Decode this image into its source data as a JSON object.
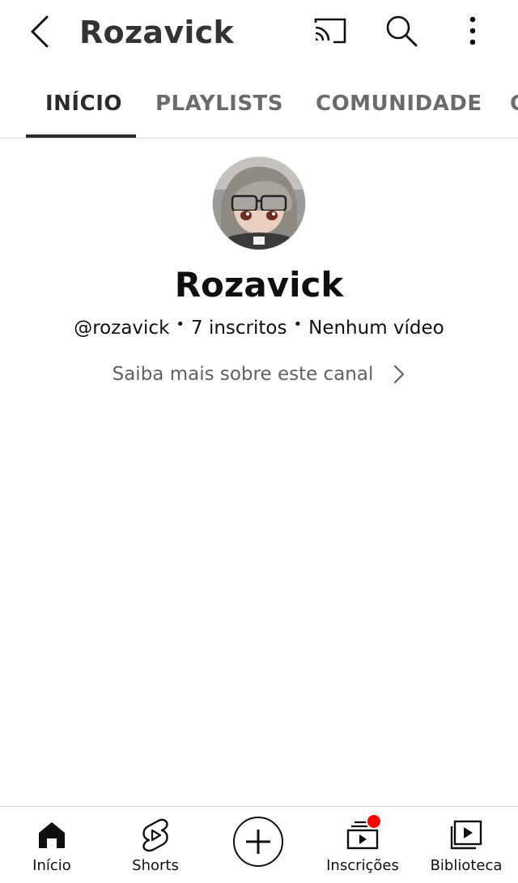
{
  "header": {
    "title": "Rozavick"
  },
  "tabs": [
    {
      "label": "INÍCIO",
      "active": true
    },
    {
      "label": "PLAYLISTS",
      "active": false
    },
    {
      "label": "COMUNIDADE",
      "active": false
    },
    {
      "label": "C",
      "active": false
    }
  ],
  "channel": {
    "name": "Rozavick",
    "handle": "@rozavick",
    "subscribers": "7 inscritos",
    "videos": "Nenhum vídeo",
    "separator": "•",
    "about_link": "Saiba mais sobre este canal"
  },
  "bottom_nav": {
    "items": [
      {
        "label": "Início",
        "icon": "home-icon"
      },
      {
        "label": "Shorts",
        "icon": "shorts-icon"
      },
      {
        "label": "",
        "icon": "create-icon"
      },
      {
        "label": "Inscrições",
        "icon": "subscriptions-icon",
        "has_notification": true
      },
      {
        "label": "Biblioteca",
        "icon": "library-icon"
      }
    ]
  },
  "colors": {
    "notification": "#ff0000",
    "text_primary": "#0f0f0f",
    "text_secondary": "#606060"
  }
}
